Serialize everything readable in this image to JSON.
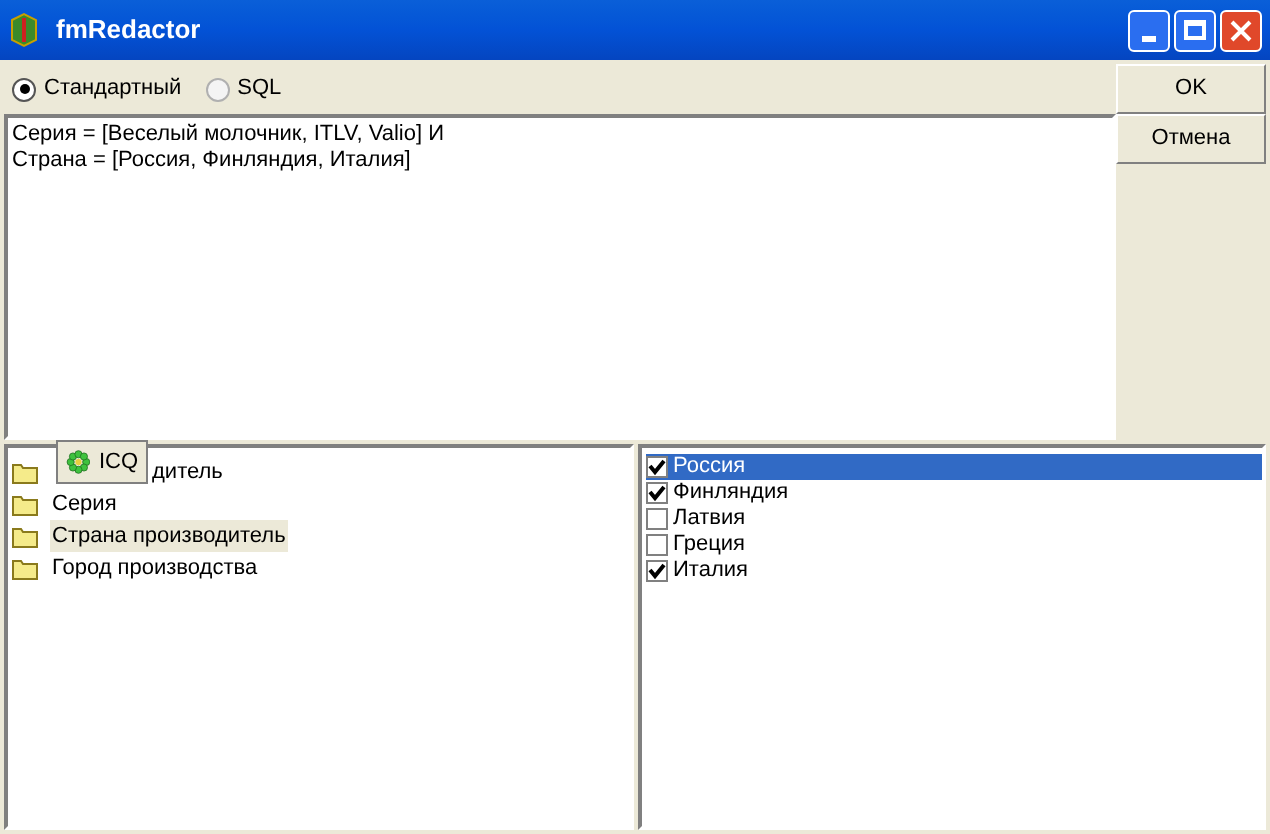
{
  "window": {
    "title": "fmRedactor"
  },
  "mode_options": [
    {
      "label": "Стандартный",
      "selected": true
    },
    {
      "label": "SQL",
      "selected": false
    }
  ],
  "buttons": [
    "OK",
    "Отмена"
  ],
  "filter_text": [
    "Серия = [Веселый молочник, ITLV, Valio] И",
    "Страна = [Россия, Финляндия, Италия]"
  ],
  "tooltip": {
    "label": "ICQ"
  },
  "fields": [
    {
      "label": "дитель",
      "selected": false
    },
    {
      "label": "Серия",
      "selected": false
    },
    {
      "label": "Страна производитель",
      "selected": true
    },
    {
      "label": "Город производства",
      "selected": false
    }
  ],
  "values": [
    {
      "label": "Россия",
      "checked": true,
      "selected": true
    },
    {
      "label": "Финляндия",
      "checked": true,
      "selected": false
    },
    {
      "label": "Латвия",
      "checked": false,
      "selected": false
    },
    {
      "label": "Греция",
      "checked": false,
      "selected": false
    },
    {
      "label": "Италия",
      "checked": true,
      "selected": false
    }
  ]
}
